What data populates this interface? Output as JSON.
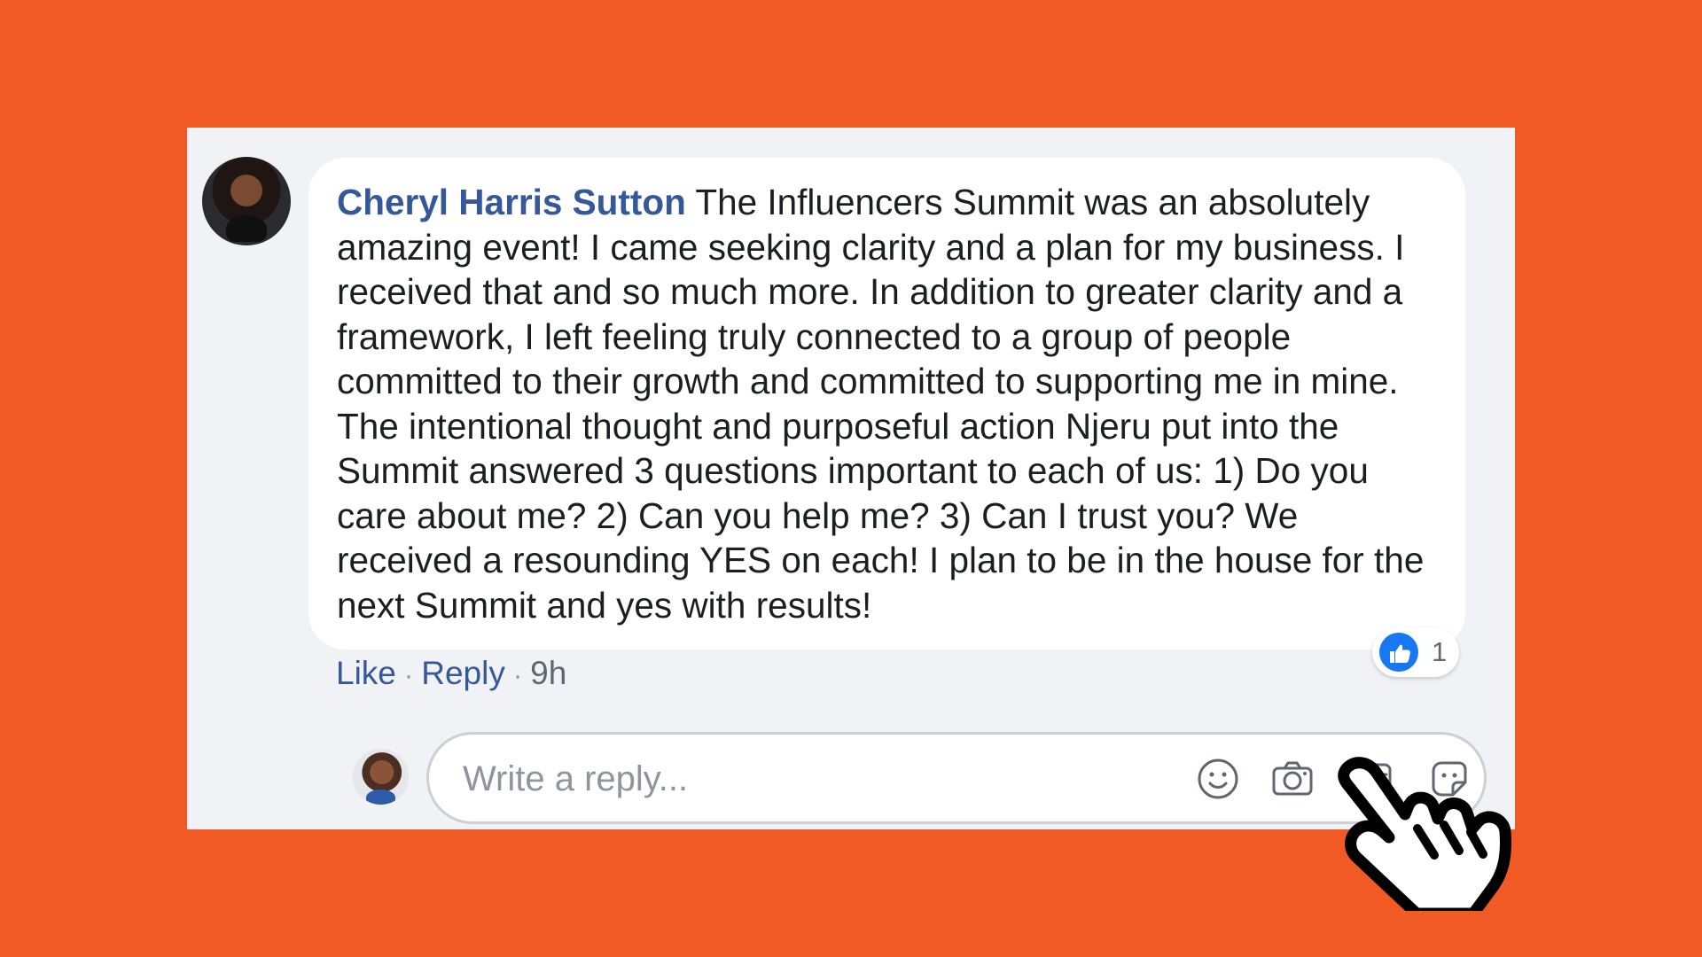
{
  "comment": {
    "author": "Cheryl Harris Sutton",
    "text": "The Influencers Summit was an absolutely amazing event! I came seeking clarity and a plan for my business. I received that and so much more. In addition to greater clarity and a framework, I left feeling truly connected to a group of people committed to their growth and committed to supporting me in mine. The intentional thought and purposeful action Njeru put into the Summit answered 3 questions important to each of us: 1) Do you care about me? 2) Can you help me? 3) Can I trust you? We received a resounding YES on each! I plan to be in the house for the next Summit and yes with results!",
    "like_label": "Like",
    "reply_label": "Reply",
    "separator": "·",
    "timestamp": "9h",
    "reaction_count": "1"
  },
  "reply": {
    "placeholder": "Write a reply..."
  },
  "icons": {
    "reaction": "thumbs-up-icon",
    "emoji": "smiley-icon",
    "photo": "camera-icon",
    "gif": "gif-icon",
    "sticker": "sticker-icon",
    "cursor": "hand-pointer-icon"
  },
  "colors": {
    "background": "#f15a24",
    "card": "#f0f2f5",
    "bubble": "#ffffff",
    "author": "#365899",
    "reaction": "#1877f2"
  }
}
